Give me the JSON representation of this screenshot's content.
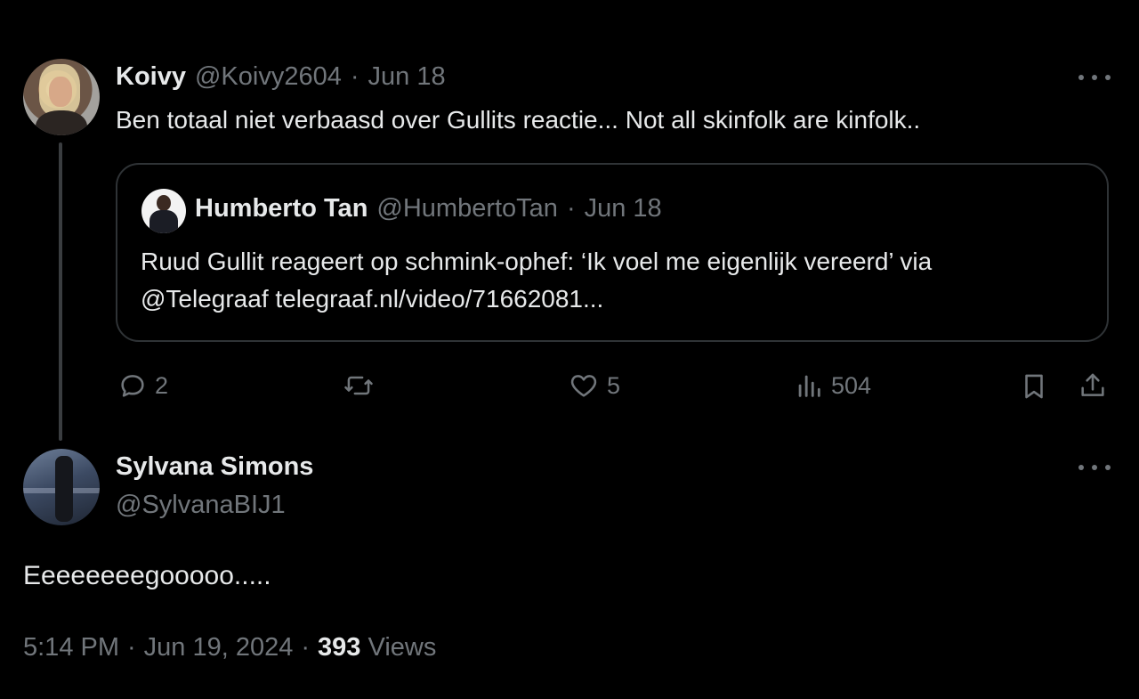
{
  "parent_tweet": {
    "author_name": "Koivy",
    "author_handle": "@Koivy2604",
    "separator": "·",
    "date": "Jun 18",
    "text": "Ben totaal niet verbaasd over Gullits reactie... Not all skinfolk are kinfolk..",
    "quote": {
      "author_name": "Humberto Tan",
      "author_handle": "@HumbertoTan",
      "separator": "·",
      "date": "Jun 18",
      "line1": "Ruud Gullit reageert op schmink-ophef: ‘Ik voel me eigenlijk vereerd’ via",
      "line2": "@Telegraaf telegraaf.nl/video/71662081..."
    },
    "actions": {
      "replies": "2",
      "reposts": "",
      "likes": "5",
      "views": "504"
    }
  },
  "main_tweet": {
    "author_name": "Sylvana Simons",
    "author_handle": "@SylvanaBIJ1",
    "text": "Eeeeeeeegooooo.....",
    "time": "5:14 PM",
    "separator1": "·",
    "date": "Jun 19, 2024",
    "separator2": "·",
    "views_count": "393",
    "views_label": "Views"
  },
  "icons": {
    "more": "more-horizontal-icon",
    "reply": "reply-icon",
    "repost": "repost-icon",
    "like": "heart-icon",
    "views": "analytics-icon",
    "bookmark": "bookmark-icon",
    "share": "share-icon"
  },
  "colors": {
    "background": "#000000",
    "text_primary": "#e7e9ea",
    "text_muted": "#71767b",
    "border": "#2f3336"
  }
}
